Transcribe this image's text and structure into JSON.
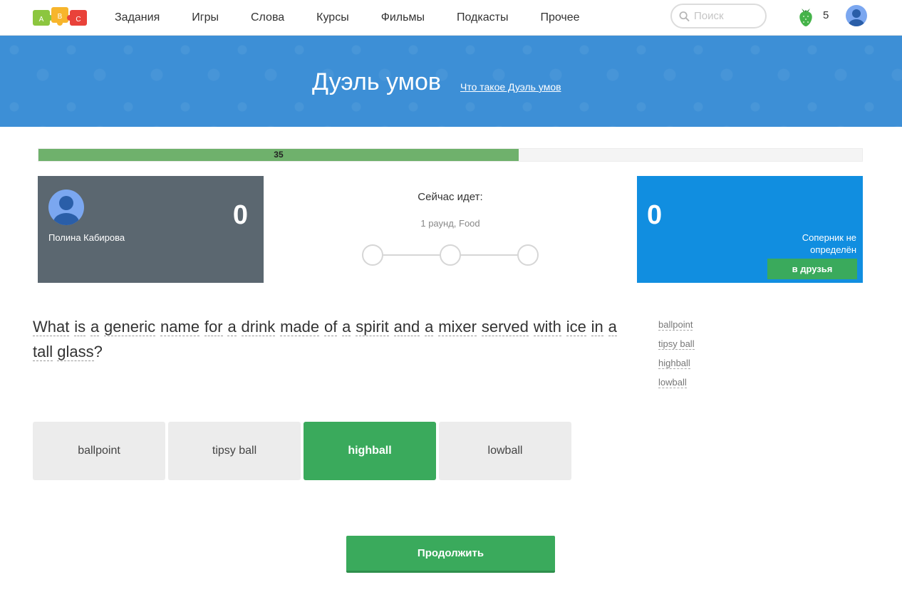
{
  "header": {
    "logo_letters": [
      "A",
      "B",
      "C"
    ],
    "nav": [
      "Задания",
      "Игры",
      "Слова",
      "Курсы",
      "Фильмы",
      "Подкасты",
      "Прочее"
    ],
    "search_placeholder": "Поиск",
    "berry_count": "5",
    "icons": {
      "search": "search-icon",
      "berry": "strawberry-icon",
      "avatar": "user-avatar-icon"
    }
  },
  "banner": {
    "title": "Дуэль умов",
    "link": "Что такое Дуэль умов"
  },
  "progress": {
    "value": 35,
    "percent": 58.3,
    "color": "#6fb16c"
  },
  "player": {
    "name": "Полина Кабирова",
    "score": "0"
  },
  "round": {
    "title": "Сейчас идет:",
    "info": "1 раунд, Food",
    "steps": 3
  },
  "opponent": {
    "score": "0",
    "status": "Соперник не определён",
    "friend_button": "в друзья"
  },
  "question": {
    "words": [
      "What",
      "is",
      "a",
      "generic",
      "name",
      "for",
      "a",
      "drink",
      "made",
      "of",
      "a",
      "spirit",
      "and",
      "a",
      "mixer",
      "served",
      "with",
      "ice",
      "in",
      "a",
      "tall",
      "glass"
    ],
    "ending": "?"
  },
  "side_words": [
    "ballpoint",
    "tipsy ball",
    "highball",
    "lowball"
  ],
  "answers": [
    {
      "label": "ballpoint",
      "state": "default"
    },
    {
      "label": "tipsy ball",
      "state": "default"
    },
    {
      "label": "highball",
      "state": "correct"
    },
    {
      "label": "lowball",
      "state": "default"
    }
  ],
  "continue_button": "Продолжить",
  "colors": {
    "banner": "#3d8fd6",
    "player_card": "#5b6770",
    "opponent_card": "#118ee0",
    "green": "#3aaa5c"
  }
}
